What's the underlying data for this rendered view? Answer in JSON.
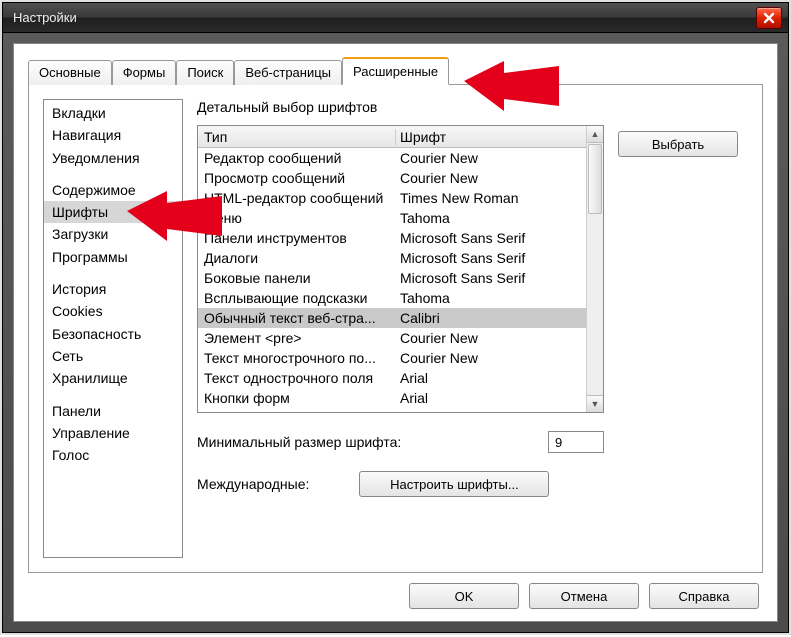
{
  "window": {
    "title": "Настройки"
  },
  "tabs": [
    {
      "label": "Основные"
    },
    {
      "label": "Формы"
    },
    {
      "label": "Поиск"
    },
    {
      "label": "Веб-страницы"
    },
    {
      "label": "Расширенные"
    }
  ],
  "sidebar": {
    "groups": [
      [
        "Вкладки",
        "Навигация",
        "Уведомления"
      ],
      [
        "Содержимое",
        "Шрифты",
        "Загрузки",
        "Программы"
      ],
      [
        "История",
        "Cookies",
        "Безопасность",
        "Сеть",
        "Хранилище"
      ],
      [
        "Панели",
        "Управление",
        "Голос"
      ]
    ],
    "selected": "Шрифты"
  },
  "fonts": {
    "heading": "Детальный выбор шрифтов",
    "columns": {
      "type": "Тип",
      "font": "Шрифт"
    },
    "rows": [
      {
        "type": "Редактор сообщений",
        "font": "Courier New"
      },
      {
        "type": "Просмотр сообщений",
        "font": "Courier New"
      },
      {
        "type": "HTML-редактор сообщений",
        "font": "Times New Roman"
      },
      {
        "type": "Меню",
        "font": "Tahoma"
      },
      {
        "type": "Панели инструментов",
        "font": "Microsoft Sans Serif"
      },
      {
        "type": "Диалоги",
        "font": "Microsoft Sans Serif"
      },
      {
        "type": "Боковые панели",
        "font": "Microsoft Sans Serif"
      },
      {
        "type": "Всплывающие подсказки",
        "font": "Tahoma"
      },
      {
        "type": "Обычный текст веб-стра...",
        "font": "Calibri",
        "selected": true
      },
      {
        "type": "Элемент <pre>",
        "font": "Courier New"
      },
      {
        "type": "Текст многострочного по...",
        "font": "Courier New"
      },
      {
        "type": "Текст однострочного поля",
        "font": "Arial"
      },
      {
        "type": "Кнопки форм",
        "font": "Arial"
      }
    ],
    "choose_btn": "Выбрать",
    "min_size_label": "Минимальный размер шрифта:",
    "min_size_value": "9",
    "intl_label": "Международные:",
    "intl_btn": "Настроить шрифты..."
  },
  "buttons": {
    "ok": "OK",
    "cancel": "Отмена",
    "help": "Справка"
  }
}
